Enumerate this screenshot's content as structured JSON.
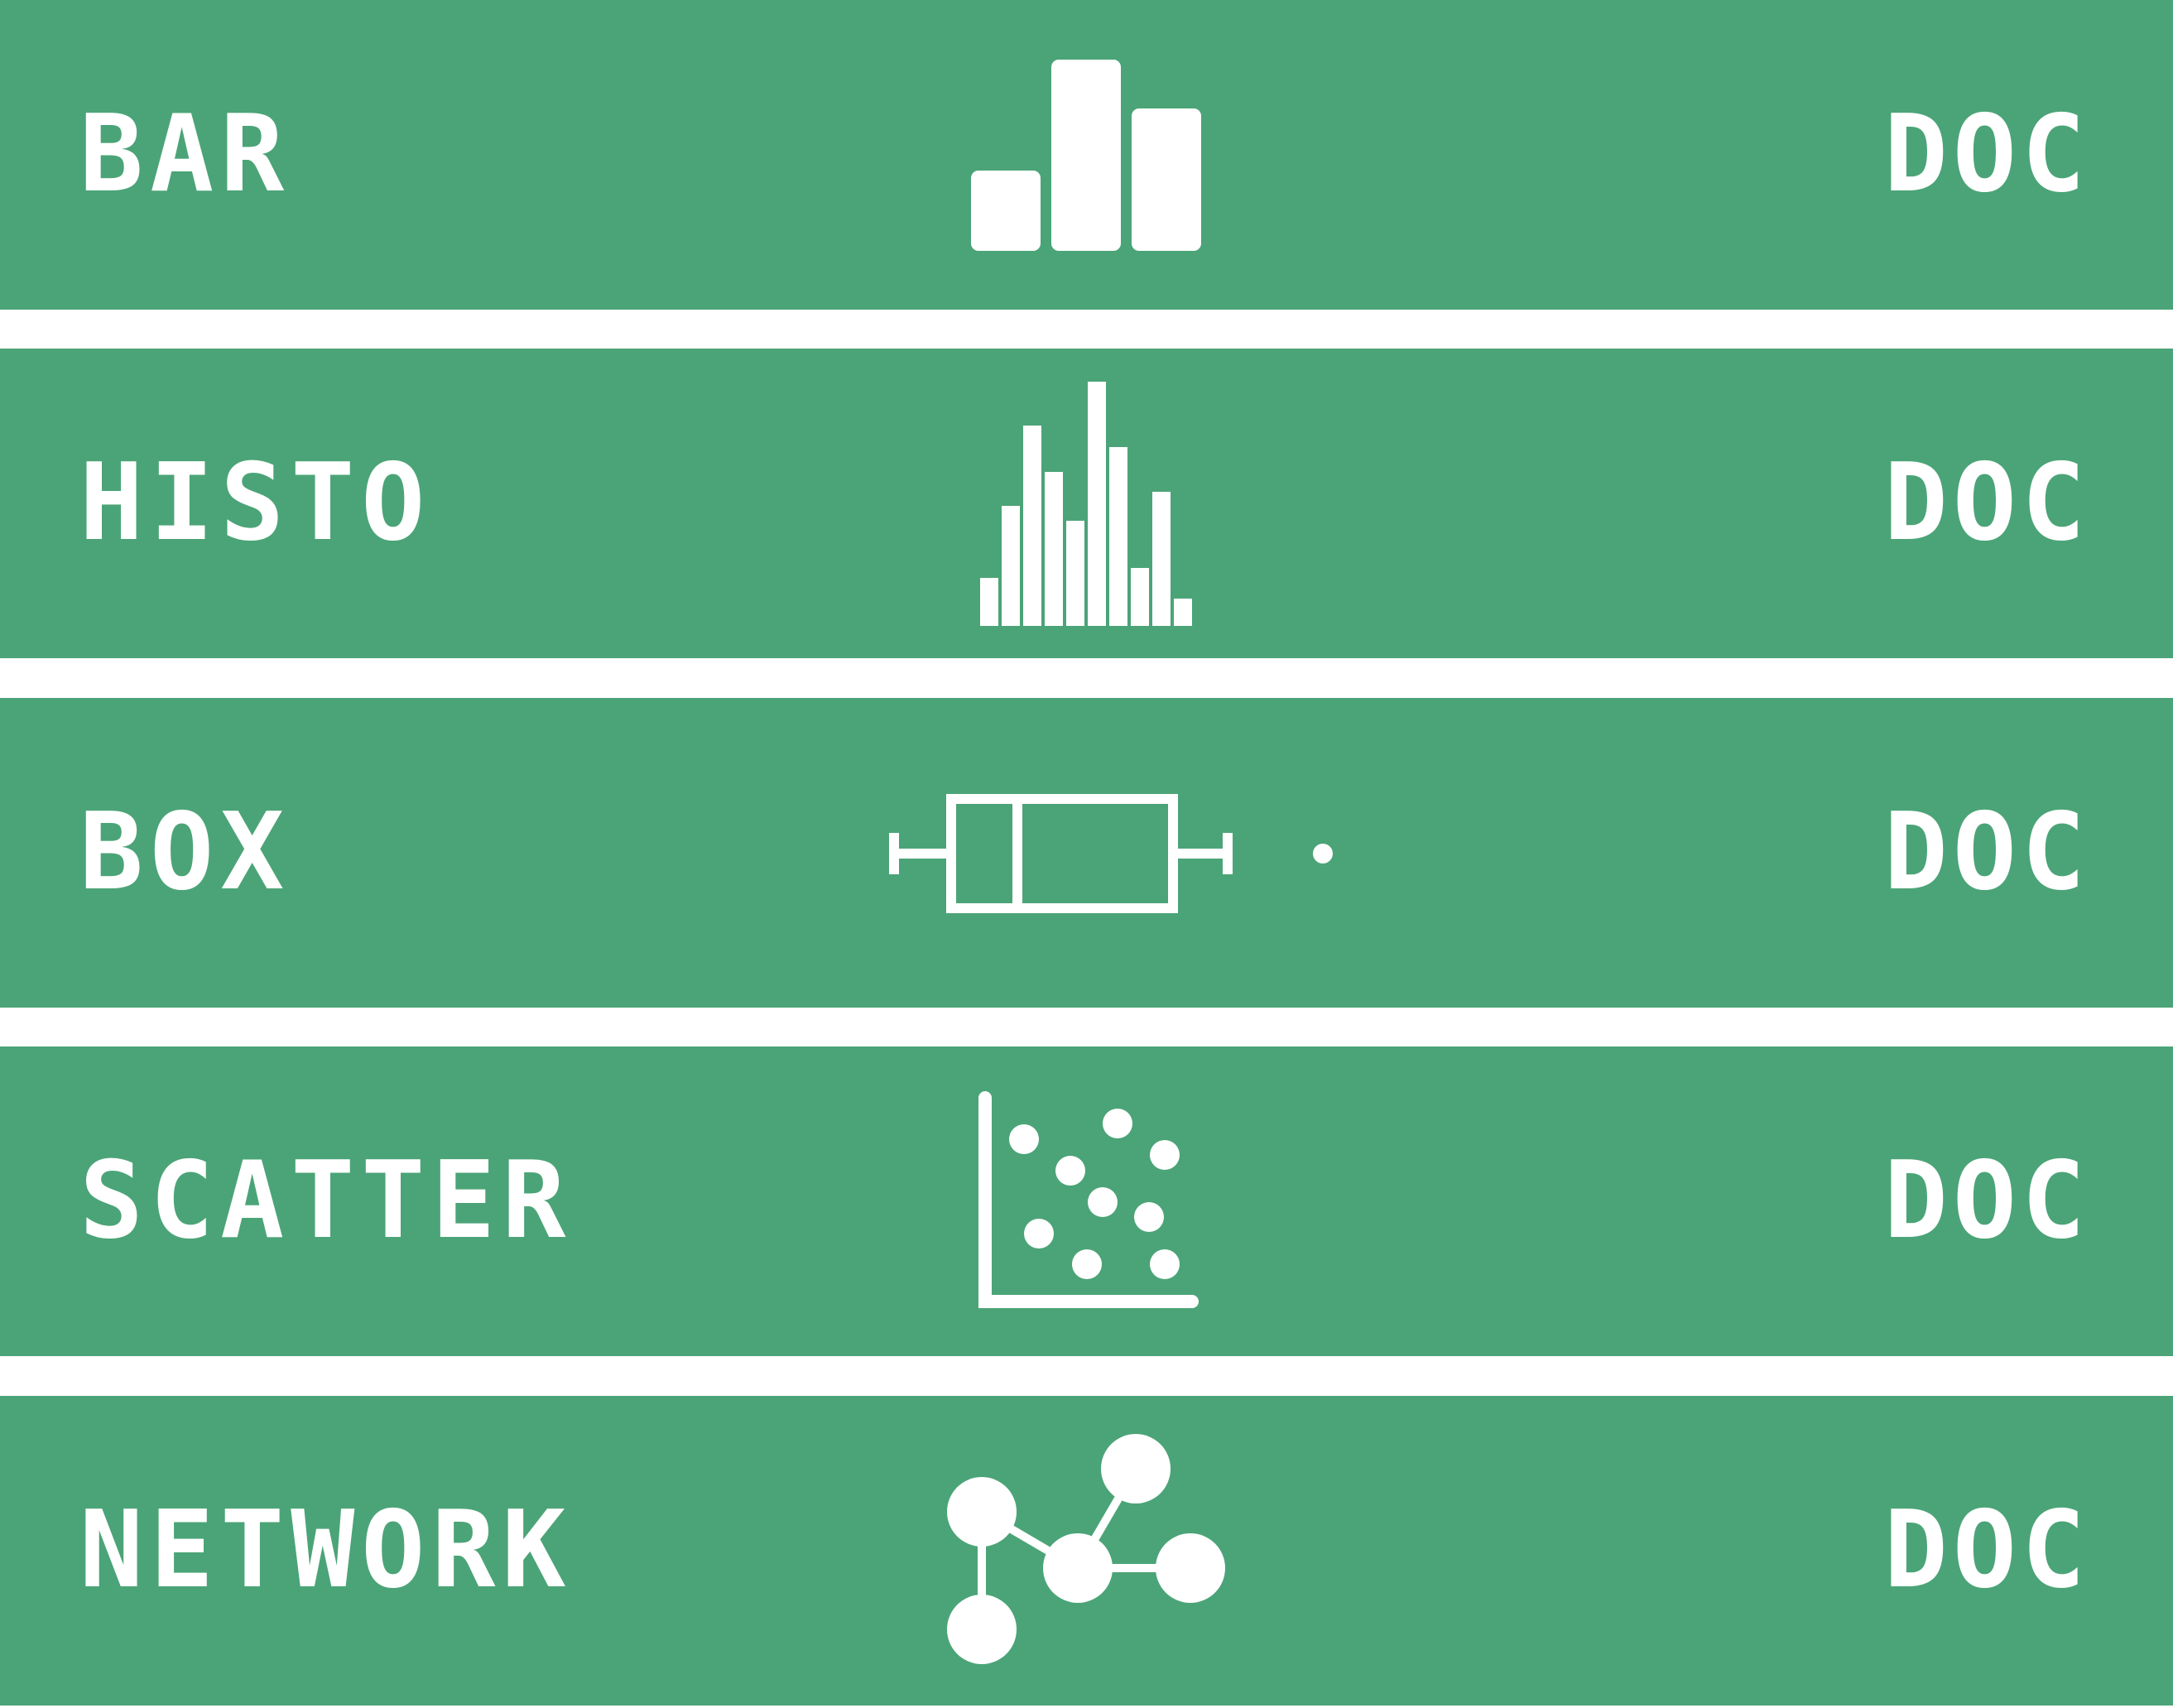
{
  "theme": {
    "row_background": "#4ba477",
    "foreground": "#ffffff",
    "page_background": "#ffffff"
  },
  "rows": [
    {
      "label": "BAR",
      "icon": "bar-chart-icon",
      "doc_label": "DOC"
    },
    {
      "label": "HISTO",
      "icon": "histogram-icon",
      "doc_label": "DOC"
    },
    {
      "label": "BOX",
      "icon": "box-plot-icon",
      "doc_label": "DOC"
    },
    {
      "label": "SCATTER",
      "icon": "scatter-plot-icon",
      "doc_label": "DOC"
    },
    {
      "label": "NETWORK",
      "icon": "network-graph-icon",
      "doc_label": "DOC"
    }
  ]
}
